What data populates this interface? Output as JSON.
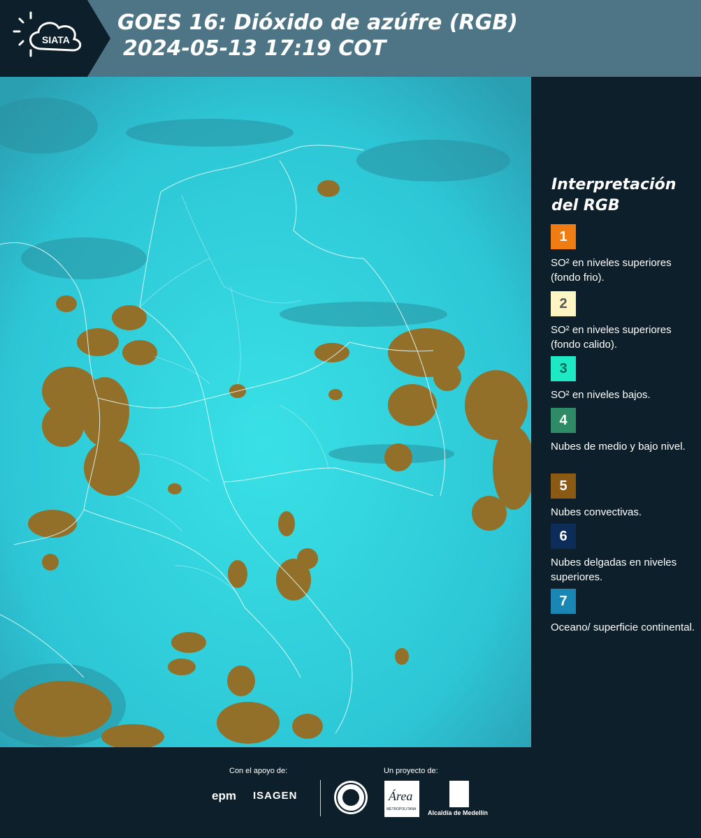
{
  "header": {
    "logo_text": "SIATA",
    "title_line1": "GOES 16: Dióxido de azúfre (RGB)",
    "title_line2": "2024-05-13 17:19 COT"
  },
  "legend": {
    "title_line1": "Interpretación",
    "title_line2": "del RGB",
    "items": [
      {
        "number": "1",
        "color": "#f07d14",
        "text": "SO² en niveles superiores (fondo frio)."
      },
      {
        "number": "2",
        "color": "#fdf6c3",
        "text": "SO² en niveles superiores (fondo calido)."
      },
      {
        "number": "3",
        "color": "#1de9c5",
        "text": "SO² en niveles bajos."
      },
      {
        "number": "4",
        "color": "#2e8b66",
        "text": "Nubes de medio y bajo nivel."
      },
      {
        "number": "5",
        "color": "#8a5a14",
        "text": "Nubes convectivas."
      },
      {
        "number": "6",
        "color": "#0c2c5a",
        "text": "Nubes delgadas en niveles superiores."
      },
      {
        "number": "7",
        "color": "#1a86b4",
        "text": "Oceano/ superficie continental."
      }
    ]
  },
  "footer": {
    "support_label": "Con el apoyo de:",
    "project_label": "Un proyecto de:",
    "epm_text": "epm",
    "isagen_text": "ISAGEN",
    "area_text": "Área",
    "area_subtext": "METROPOLITANA",
    "alcaldia_text": "Alcaldía de Medellín"
  },
  "colors": {
    "header_bg": "#4e7585",
    "panel_bg": "#0d1f2b",
    "map_surface": "#2fd6e0",
    "cloud_brown": "#8f6e22"
  }
}
